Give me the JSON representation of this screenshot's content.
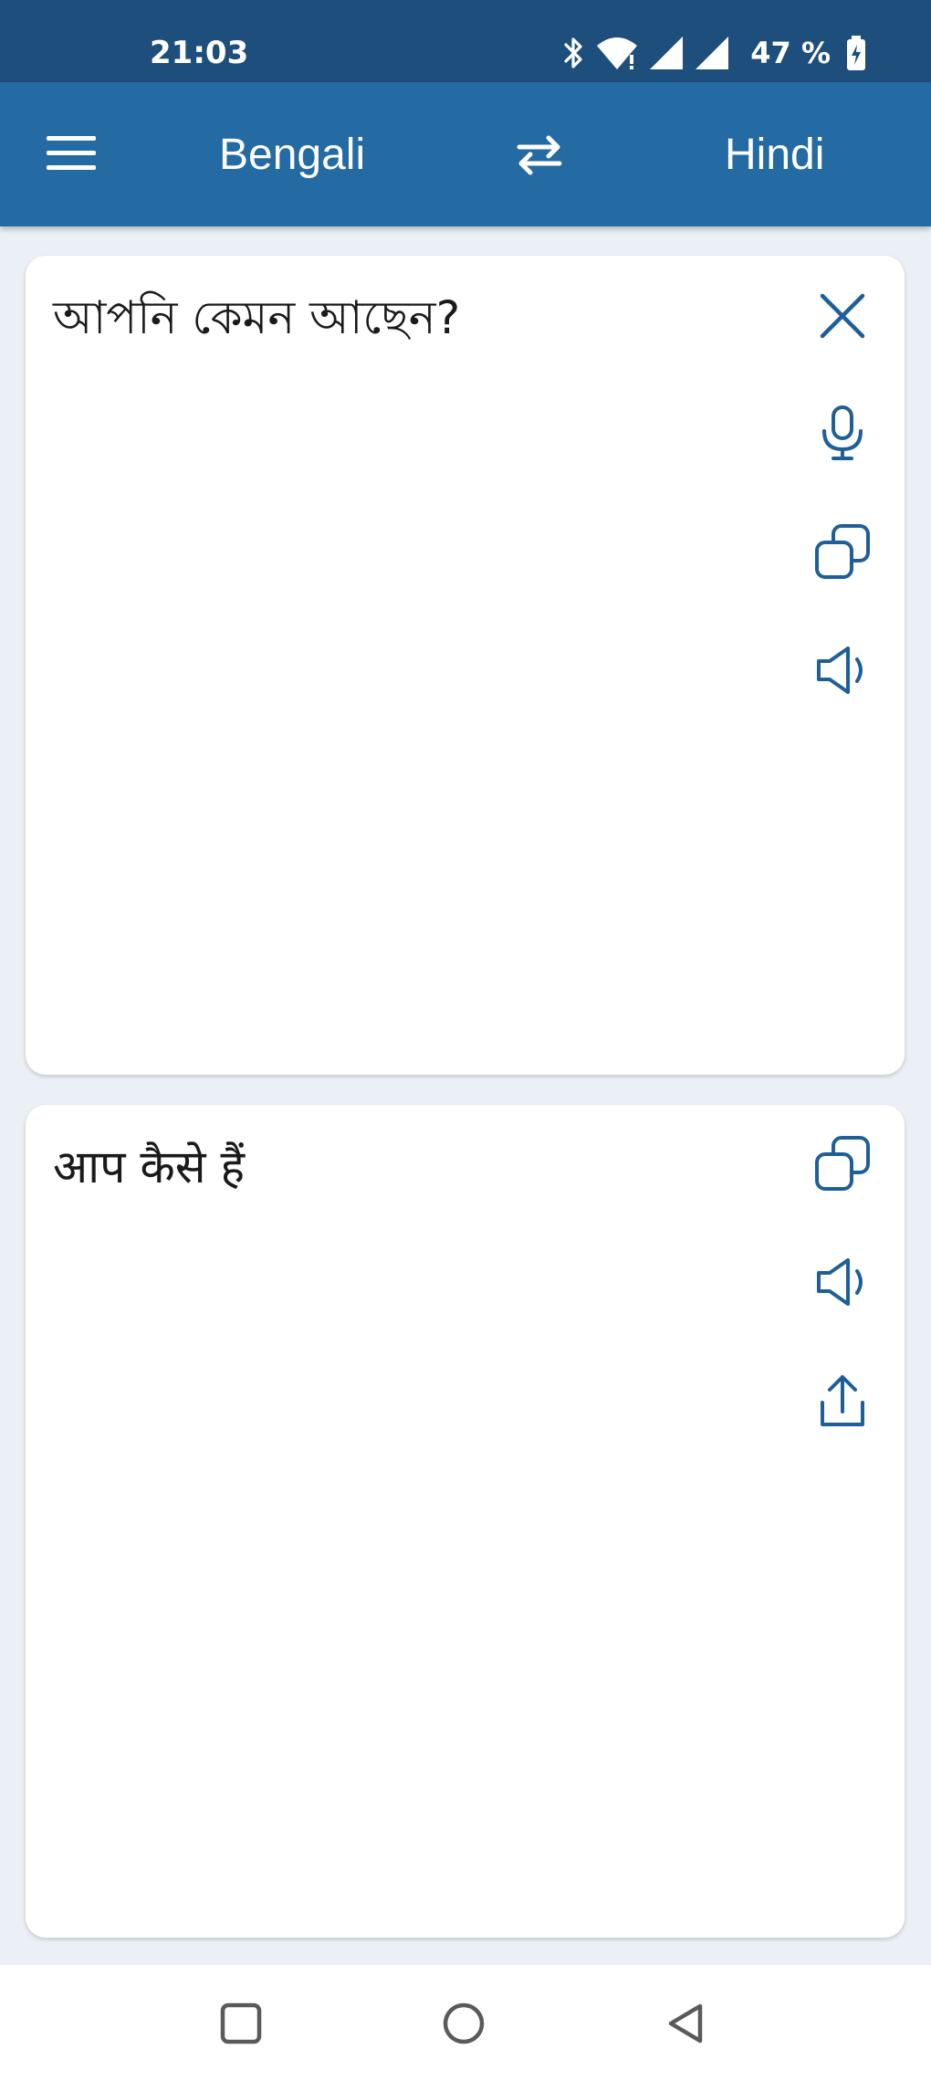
{
  "status_bar": {
    "time": "21:03",
    "battery_percent": "47 %",
    "icons": [
      "bluetooth-icon",
      "wifi-icon",
      "signal-icon",
      "signal-icon",
      "battery-charging-icon"
    ]
  },
  "app_bar": {
    "menu_icon": "hamburger-menu-icon",
    "source_language": "Bengali",
    "swap_icon": "swap-arrows-icon",
    "target_language": "Hindi"
  },
  "input_card": {
    "text": "আপনি কেমন আছেন?",
    "actions": [
      "close-icon",
      "microphone-icon",
      "copy-icon",
      "speaker-icon"
    ]
  },
  "output_card": {
    "text": "आप कैसे हैं",
    "actions": [
      "copy-icon",
      "speaker-icon",
      "share-icon"
    ]
  },
  "navigation_bar": {
    "buttons": [
      "recents-square-icon",
      "home-circle-icon",
      "back-triangle-icon"
    ]
  },
  "colors": {
    "status_bar": "#1d4e7c",
    "app_bar": "#246aa3",
    "background": "#eaf0f6",
    "icon_accent": "#1f5f99",
    "card": "#ffffff"
  }
}
